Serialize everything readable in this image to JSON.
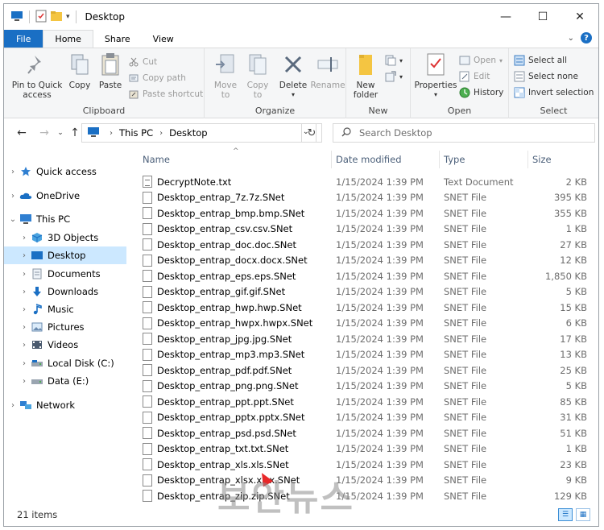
{
  "window": {
    "title": "Desktop",
    "controls": {
      "minimize": "—",
      "maximize": "☐",
      "close": "✕"
    }
  },
  "tabs": [
    "File",
    "Home",
    "Share",
    "View"
  ],
  "ribbon": {
    "clipboard": {
      "label": "Clipboard",
      "pin_label_1": "Pin to Quick",
      "pin_label_2": "access",
      "copy": "Copy",
      "paste": "Paste",
      "cut": "Cut",
      "copy_path": "Copy path",
      "paste_shortcut": "Paste shortcut"
    },
    "organize": {
      "label": "Organize",
      "move_to_1": "Move",
      "move_to_2": "to",
      "copy_to_1": "Copy",
      "copy_to_2": "to",
      "delete": "Delete",
      "rename": "Rename"
    },
    "new": {
      "label": "New",
      "new_folder_1": "New",
      "new_folder_2": "folder"
    },
    "open": {
      "label": "Open",
      "properties": "Properties",
      "open": "Open",
      "edit": "Edit",
      "history": "History"
    },
    "select": {
      "label": "Select",
      "select_all": "Select all",
      "select_none": "Select none",
      "invert": "Invert selection"
    }
  },
  "address": {
    "crumbs": [
      "This PC",
      "Desktop"
    ],
    "search_placeholder": "Search Desktop"
  },
  "nav": {
    "items": [
      {
        "label": "Quick access",
        "icon": "star-icon"
      },
      {
        "label": "OneDrive",
        "icon": "cloud-icon"
      },
      {
        "label": "This PC",
        "icon": "computer-icon"
      },
      {
        "label": "3D Objects",
        "icon": "cube-icon"
      },
      {
        "label": "Desktop",
        "icon": "desktop-icon"
      },
      {
        "label": "Documents",
        "icon": "documents-icon"
      },
      {
        "label": "Downloads",
        "icon": "download-icon"
      },
      {
        "label": "Music",
        "icon": "music-icon"
      },
      {
        "label": "Pictures",
        "icon": "pictures-icon"
      },
      {
        "label": "Videos",
        "icon": "videos-icon"
      },
      {
        "label": "Local Disk (C:)",
        "icon": "drive-icon"
      },
      {
        "label": "Data (E:)",
        "icon": "drive-icon"
      },
      {
        "label": "Network",
        "icon": "network-icon"
      }
    ]
  },
  "columns": {
    "name": "Name",
    "date": "Date modified",
    "type": "Type",
    "size": "Size"
  },
  "files": [
    {
      "name": "DecryptNote.txt",
      "date": "1/15/2024 1:39 PM",
      "type": "Text Document",
      "size": "2 KB"
    },
    {
      "name": "Desktop_entrap_7z.7z.SNet",
      "date": "1/15/2024 1:39 PM",
      "type": "SNET File",
      "size": "395 KB"
    },
    {
      "name": "Desktop_entrap_bmp.bmp.SNet",
      "date": "1/15/2024 1:39 PM",
      "type": "SNET File",
      "size": "355 KB"
    },
    {
      "name": "Desktop_entrap_csv.csv.SNet",
      "date": "1/15/2024 1:39 PM",
      "type": "SNET File",
      "size": "1 KB"
    },
    {
      "name": "Desktop_entrap_doc.doc.SNet",
      "date": "1/15/2024 1:39 PM",
      "type": "SNET File",
      "size": "27 KB"
    },
    {
      "name": "Desktop_entrap_docx.docx.SNet",
      "date": "1/15/2024 1:39 PM",
      "type": "SNET File",
      "size": "12 KB"
    },
    {
      "name": "Desktop_entrap_eps.eps.SNet",
      "date": "1/15/2024 1:39 PM",
      "type": "SNET File",
      "size": "1,850 KB"
    },
    {
      "name": "Desktop_entrap_gif.gif.SNet",
      "date": "1/15/2024 1:39 PM",
      "type": "SNET File",
      "size": "5 KB"
    },
    {
      "name": "Desktop_entrap_hwp.hwp.SNet",
      "date": "1/15/2024 1:39 PM",
      "type": "SNET File",
      "size": "15 KB"
    },
    {
      "name": "Desktop_entrap_hwpx.hwpx.SNet",
      "date": "1/15/2024 1:39 PM",
      "type": "SNET File",
      "size": "6 KB"
    },
    {
      "name": "Desktop_entrap_jpg.jpg.SNet",
      "date": "1/15/2024 1:39 PM",
      "type": "SNET File",
      "size": "17 KB"
    },
    {
      "name": "Desktop_entrap_mp3.mp3.SNet",
      "date": "1/15/2024 1:39 PM",
      "type": "SNET File",
      "size": "13 KB"
    },
    {
      "name": "Desktop_entrap_pdf.pdf.SNet",
      "date": "1/15/2024 1:39 PM",
      "type": "SNET File",
      "size": "25 KB"
    },
    {
      "name": "Desktop_entrap_png.png.SNet",
      "date": "1/15/2024 1:39 PM",
      "type": "SNET File",
      "size": "5 KB"
    },
    {
      "name": "Desktop_entrap_ppt.ppt.SNet",
      "date": "1/15/2024 1:39 PM",
      "type": "SNET File",
      "size": "85 KB"
    },
    {
      "name": "Desktop_entrap_pptx.pptx.SNet",
      "date": "1/15/2024 1:39 PM",
      "type": "SNET File",
      "size": "31 KB"
    },
    {
      "name": "Desktop_entrap_psd.psd.SNet",
      "date": "1/15/2024 1:39 PM",
      "type": "SNET File",
      "size": "51 KB"
    },
    {
      "name": "Desktop_entrap_txt.txt.SNet",
      "date": "1/15/2024 1:39 PM",
      "type": "SNET File",
      "size": "1 KB"
    },
    {
      "name": "Desktop_entrap_xls.xls.SNet",
      "date": "1/15/2024 1:39 PM",
      "type": "SNET File",
      "size": "23 KB"
    },
    {
      "name": "Desktop_entrap_xlsx.xlsx.SNet",
      "date": "1/15/2024 1:39 PM",
      "type": "SNET File",
      "size": "9 KB"
    },
    {
      "name": "Desktop_entrap_zip.zip.SNet",
      "date": "1/15/2024 1:39 PM",
      "type": "SNET File",
      "size": "129 KB"
    }
  ],
  "status": {
    "item_count": "21 items"
  },
  "watermark": "보안뉴스",
  "colors": {
    "accent": "#1a6fc4",
    "selected": "#cce8ff",
    "muted_text": "#6d6d6d",
    "header_text": "#4c607a"
  }
}
